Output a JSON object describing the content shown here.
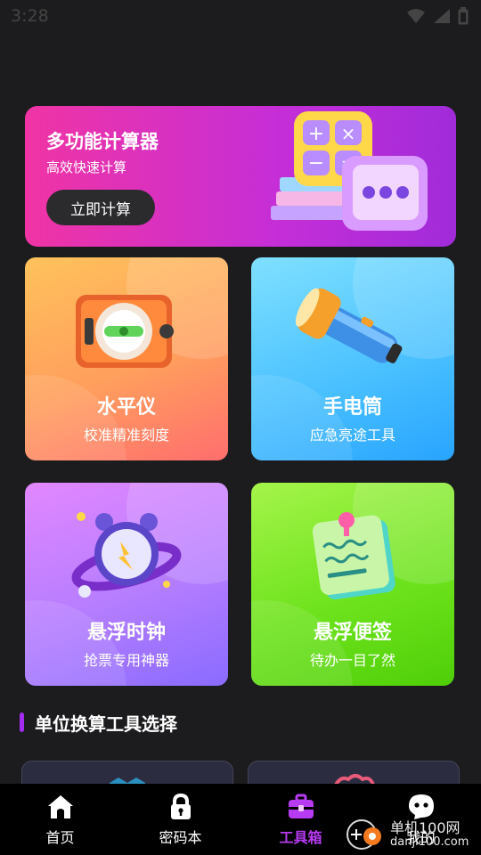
{
  "status_bar": {
    "time": "3:28",
    "icons": [
      "wifi-icon",
      "signal-icon",
      "battery-icon"
    ]
  },
  "banner": {
    "title": "多功能计算器",
    "subtitle": "高效快速计算",
    "button_label": "立即计算",
    "art": "calculator-illustration"
  },
  "tools": [
    {
      "title": "水平仪",
      "subtitle": "校准精准刻度",
      "art": "level-gauge-illustration"
    },
    {
      "title": "手电筒",
      "subtitle": "应急亮途工具",
      "art": "flashlight-illustration"
    },
    {
      "title": "悬浮时钟",
      "subtitle": "抢票专用神器",
      "art": "alarm-clock-illustration"
    },
    {
      "title": "悬浮便签",
      "subtitle": "待办一目了然",
      "art": "sticky-note-illustration"
    }
  ],
  "section": {
    "title": "单位换算工具选择"
  },
  "nav": {
    "items": [
      {
        "label": "首页",
        "icon": "home-icon"
      },
      {
        "label": "密码本",
        "icon": "lock-icon"
      },
      {
        "label": "工具箱",
        "icon": "toolbox-icon",
        "active": true
      },
      {
        "label": "我的",
        "icon": "profile-icon"
      }
    ]
  },
  "watermark": {
    "line1": "单机100网",
    "line2": "danji100.com"
  },
  "colors": {
    "background": "#1c1c1e",
    "accent": "#b73bf2",
    "banner_start": "#f034a4",
    "banner_end": "#a12bd9"
  }
}
